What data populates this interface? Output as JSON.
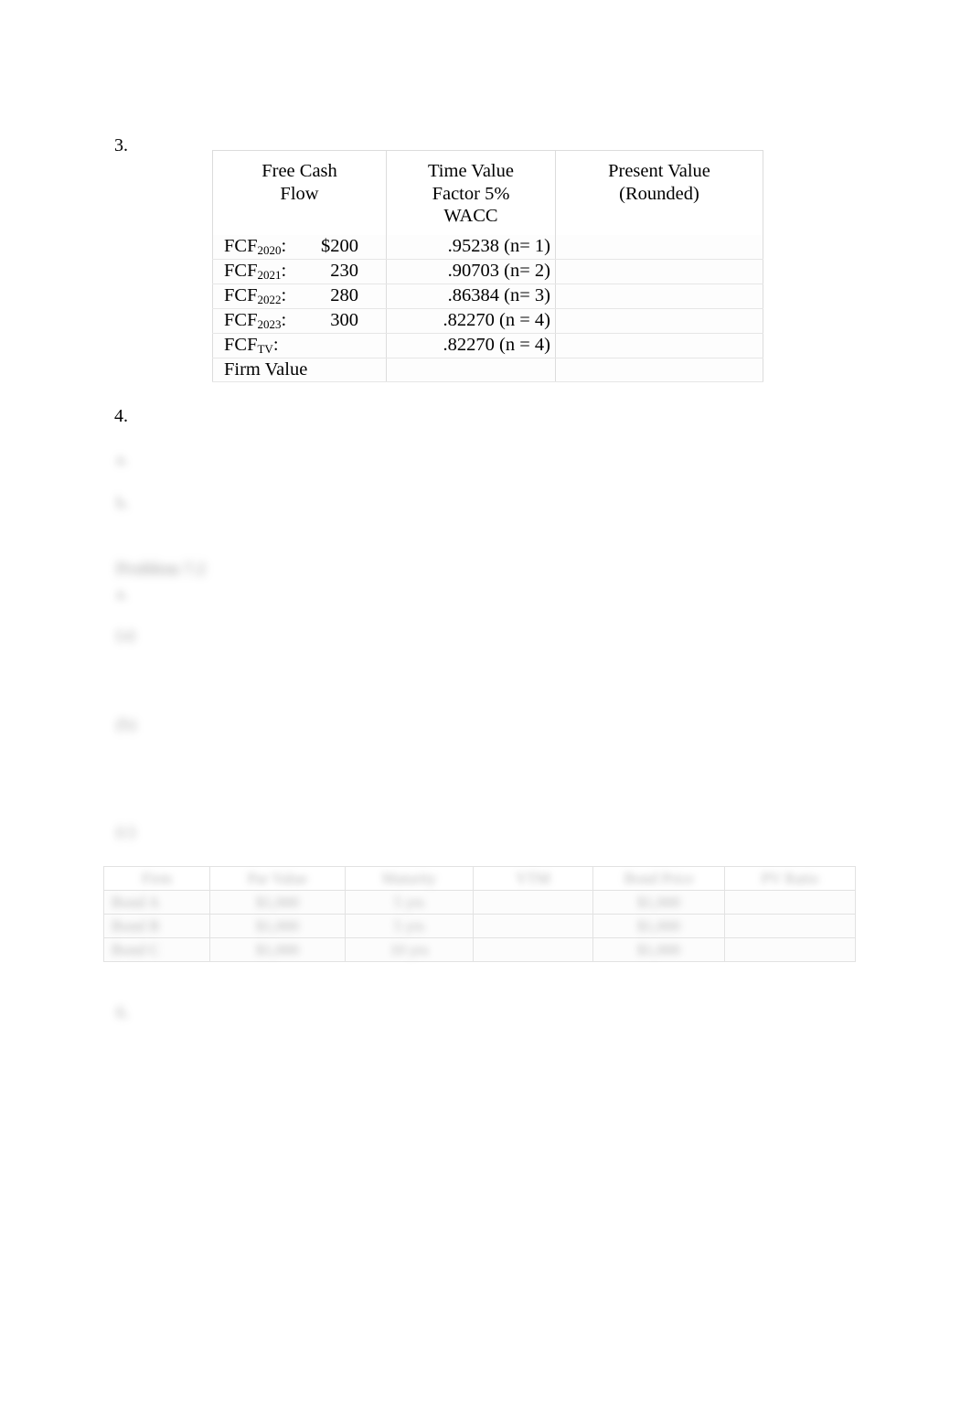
{
  "document": {
    "page_background": "#ffffff",
    "text_color": "#000000",
    "border_color": "#dcdcdc"
  },
  "questions": {
    "q3_marker": "3.",
    "q4_marker": "4."
  },
  "fcf_table": {
    "name": "free-cash-flow-valuation-table",
    "headers": [
      "Free Cash\nFlow",
      "Time Value\nFactor 5%\nWACC",
      "Present Value\n(Rounded)"
    ],
    "rows": [
      {
        "label_prefix": "FCF",
        "label_sub": "2020",
        "label_suffix": ":",
        "amount": "$200",
        "factor": ".95238 (n= 1)",
        "present_value": ""
      },
      {
        "label_prefix": "FCF",
        "label_sub": "2021",
        "label_suffix": ":",
        "amount": "230",
        "factor": ".90703 (n= 2)",
        "present_value": ""
      },
      {
        "label_prefix": "FCF",
        "label_sub": "2022",
        "label_suffix": ":",
        "amount": "280",
        "factor": ".86384 (n= 3)",
        "present_value": ""
      },
      {
        "label_prefix": "FCF",
        "label_sub": "2023",
        "label_suffix": ":",
        "amount": "300",
        "factor": ".82270 (n = 4)",
        "present_value": ""
      },
      {
        "label_prefix": "FCF",
        "label_sub": "TV",
        "label_suffix": ":",
        "amount": "",
        "factor": ".82270 (n = 4)",
        "present_value": ""
      },
      {
        "label_prefix": "Firm Value",
        "label_sub": "",
        "label_suffix": "",
        "amount": "",
        "factor": "",
        "present_value": ""
      }
    ]
  },
  "redacted": {
    "note": "text rendered blurred/illegible in the source image",
    "q4_item_a": "a.",
    "q4_item_b": "b.",
    "problem_heading": "Problem 7.2",
    "problem_sub": "a.",
    "item_5a": "(a)",
    "item_5b": "(b)",
    "item_5c": "(c)",
    "item_6": "6."
  },
  "bond_table": {
    "name": "bond-pricing-table",
    "headers": [
      "Firm",
      "Par Value",
      "Maturity",
      "YTM",
      "Bond Price",
      "PV Ratio"
    ],
    "rows": [
      {
        "firm": "Bond A",
        "par": "$1,000",
        "maturity": "5 yrs",
        "ytm": "",
        "price": "$1,000",
        "pv_ratio": ""
      },
      {
        "firm": "Bond B",
        "par": "$1,000",
        "maturity": "5 yrs",
        "ytm": "",
        "price": "$1,000",
        "pv_ratio": ""
      },
      {
        "firm": "Bond C",
        "par": "$1,000",
        "maturity": "10 yrs",
        "ytm": "",
        "price": "$1,000",
        "pv_ratio": ""
      }
    ]
  }
}
